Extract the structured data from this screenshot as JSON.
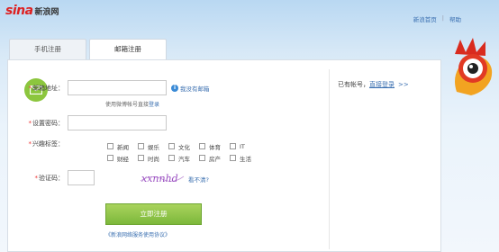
{
  "brand": {
    "logo_text": "sina",
    "logo_sub": "新浪网"
  },
  "top_links": {
    "home": "新浪首页",
    "help": "帮助"
  },
  "tabs": [
    {
      "label": "手机注册"
    },
    {
      "label": "邮箱注册"
    }
  ],
  "form": {
    "email_label": "邮箱地址：",
    "email_value": "",
    "no_email_label": "我没有邮箱",
    "email_hint_prefix": "使用微博帐号直接",
    "email_hint_link": "登录",
    "password_label": "设置密码：",
    "password_value": "",
    "interest_label": "兴趣标签：",
    "interests": [
      "新闻",
      "娱乐",
      "文化",
      "体育",
      "IT",
      "财经",
      "时尚",
      "汽车",
      "房产",
      "生活"
    ],
    "captcha_label": "验证码：",
    "captcha_value": "",
    "captcha_text": "xxnnhd",
    "captcha_refresh": "看不清?",
    "submit_label": "立即注册",
    "terms_label": "《新浪网络服务使用协议》"
  },
  "side": {
    "prompt": "已有帐号，",
    "login_link": "直接登录",
    "arrow": ">>"
  },
  "colors": {
    "accent": "#3a6fb0",
    "button": "#8cc63e",
    "required": "#e33"
  }
}
